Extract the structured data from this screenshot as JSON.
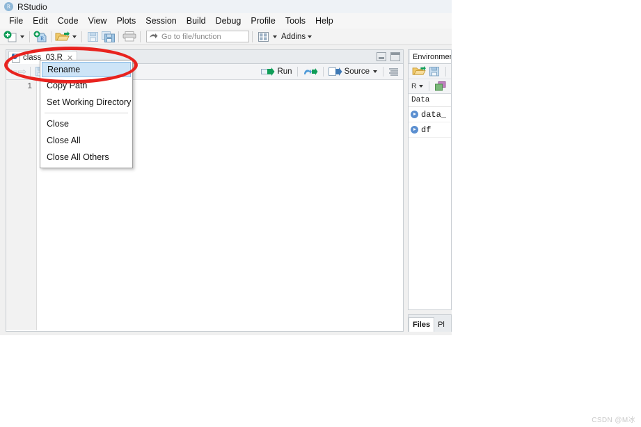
{
  "window": {
    "title": "RStudio",
    "logo_icon": "rstudio-logo-icon"
  },
  "menu_bar": {
    "items": [
      {
        "label": "File"
      },
      {
        "label": "Edit"
      },
      {
        "label": "Code"
      },
      {
        "label": "View"
      },
      {
        "label": "Plots"
      },
      {
        "label": "Session"
      },
      {
        "label": "Build"
      },
      {
        "label": "Debug"
      },
      {
        "label": "Profile"
      },
      {
        "label": "Tools"
      },
      {
        "label": "Help"
      }
    ]
  },
  "toolbar": {
    "new_file_icon": "new-file-icon",
    "new_project_icon": "new-project-icon",
    "open_file_icon": "open-folder-icon",
    "save_icon": "save-icon",
    "save_all_icon": "save-all-icon",
    "print_icon": "print-icon",
    "goto_placeholder": "Go to file/function",
    "goto_value": "",
    "goto_arrow_icon": "forward-arrow-icon",
    "panes_icon": "workspace-panes-icon",
    "addins_label": "Addins"
  },
  "source_pane": {
    "tab": {
      "file_name": "class_03.R",
      "file_icon": "r-script-icon",
      "close_icon": "close-icon"
    },
    "minimize_icon": "minimize-icon",
    "maximize_icon": "maximize-icon",
    "editor_toolbar": {
      "back_icon": "back-arrow-icon",
      "forward_icon": "forward-arrow-icon",
      "save_label": "Save",
      "find_icon": "magnifier-icon",
      "magic_icon": "code-tools-icon",
      "compile_report_icon": "compile-report-icon",
      "run_label": "Run",
      "run_icon": "run-icon",
      "rerun_icon": "rerun-icon",
      "source_label": "Source",
      "source_icon": "source-icon",
      "outline_icon": "document-outline-icon"
    },
    "line_numbers": [
      "1"
    ],
    "code_lines": [
      ""
    ]
  },
  "context_menu": {
    "items": [
      {
        "label": "Rename",
        "selected": true,
        "separator_after": false
      },
      {
        "label": "Copy Path",
        "selected": false,
        "separator_after": false
      },
      {
        "label": "Set Working Directory",
        "selected": false,
        "separator_after": true
      },
      {
        "label": "Close",
        "selected": false,
        "separator_after": false
      },
      {
        "label": "Close All",
        "selected": false,
        "separator_after": false
      },
      {
        "label": "Close All Others",
        "selected": false,
        "separator_after": false
      }
    ]
  },
  "environment_pane": {
    "tab_label": "Environment",
    "load_icon": "load-workspace-icon",
    "save_icon": "save-workspace-icon",
    "scope_label": "R",
    "grid_view_icon": "grid-view-icon",
    "section_label": "Data",
    "rows": [
      {
        "name": "data_",
        "expand_icon": "expand-icon"
      },
      {
        "name": "df",
        "expand_icon": "expand-icon"
      }
    ]
  },
  "files_pane": {
    "tabs": [
      {
        "label": "Files",
        "active": true
      },
      {
        "label": "Pl",
        "active": false
      }
    ]
  },
  "annotation": {
    "ellipse_color": "#e8231f"
  },
  "watermark": {
    "text": "CSDN @M冰"
  }
}
